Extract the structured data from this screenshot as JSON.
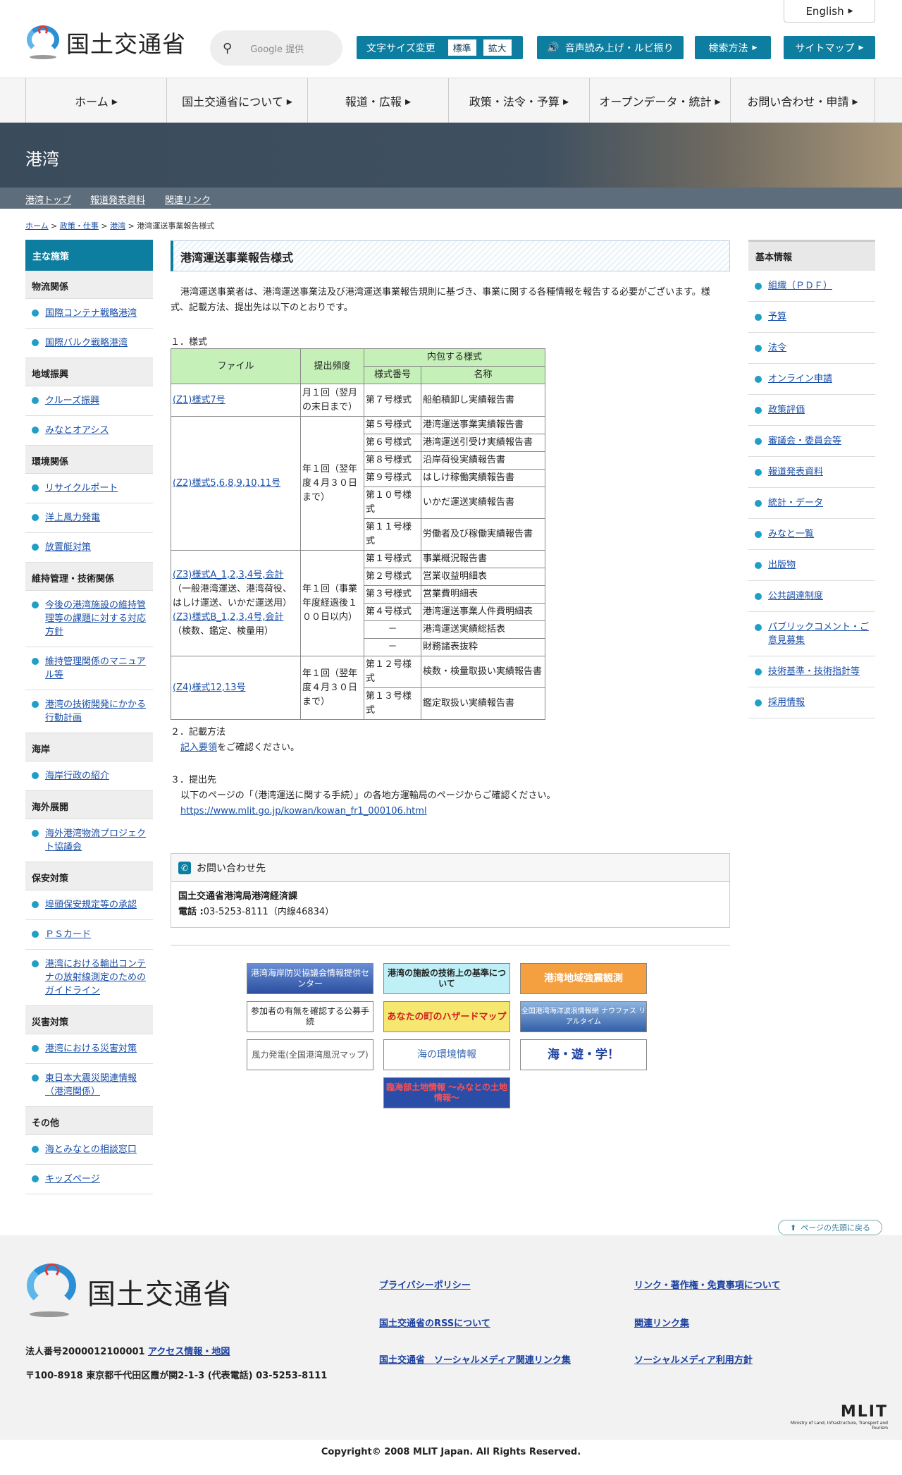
{
  "header": {
    "lang": "English",
    "logo": "国土交通省",
    "search_placeholder": "Google 提供",
    "fontsize": "文字サイズ変更",
    "fs_std": "標準",
    "fs_big": "拡大",
    "voice": "音声読み上げ・ルビ振り",
    "search_method": "検索方法",
    "sitemap": "サイトマップ"
  },
  "gnav": [
    "ホーム",
    "国土交通省について",
    "報道・広報",
    "政策・法令・予算",
    "オープンデータ・統計",
    "お問い合わせ・申請"
  ],
  "banner": {
    "title": "港湾"
  },
  "subnav": [
    "港湾トップ",
    "報道発表資料",
    "関連リンク"
  ],
  "breadcrumb": {
    "home": "ホーム",
    "policy": "政策・仕事",
    "port": "港湾",
    "current": "港湾運送事業報告様式",
    "sep": ">"
  },
  "leftnav": {
    "title": "主な施策",
    "groups": [
      {
        "cat": "物流関係",
        "links": [
          "国際コンテナ戦略港湾",
          "国際バルク戦略港湾"
        ]
      },
      {
        "cat": "地域振興",
        "links": [
          "クルーズ振興",
          "みなとオアシス"
        ]
      },
      {
        "cat": "環境関係",
        "links": [
          "リサイクルポート",
          "洋上風力発電",
          "放置艇対策"
        ]
      },
      {
        "cat": "維持管理・技術関係",
        "links": [
          "今後の港湾施設の維持管理等の課題に対する対応方針",
          "維持管理関係のマニュアル等",
          "港湾の技術開発にかかる行動計画"
        ]
      },
      {
        "cat": "海岸",
        "links": [
          "海岸行政の紹介"
        ]
      },
      {
        "cat": "海外展開",
        "links": [
          "海外港湾物流プロジェクト協議会"
        ]
      },
      {
        "cat": "保安対策",
        "links": [
          "埠頭保安規定等の承認",
          "ＰＳカード",
          "港湾における輸出コンテナの放射線測定のためのガイドライン"
        ]
      },
      {
        "cat": "災害対策",
        "links": [
          "港湾における災害対策",
          "東日本大震災関連情報（港湾関係）"
        ]
      },
      {
        "cat": "その他",
        "links": [
          "海とみなとの相談窓口",
          "キッズページ"
        ]
      }
    ]
  },
  "rightnav": {
    "title": "基本情報",
    "links": [
      "組織（ＰＤＦ）",
      "予算",
      "法令",
      "オンライン申請",
      "政策評価",
      "審議会・委員会等",
      "報道発表資料",
      "統計・データ",
      "みなと一覧",
      "出版物",
      "公共調達制度",
      "パブリックコメント・ご意見募集",
      "技術基準・技術指針等",
      "採用情報"
    ]
  },
  "main": {
    "title": "港湾運送事業報告様式",
    "intro": "港湾運送事業者は、港湾運送事業法及び港湾運送事業報告規則に基づき、事業に関する各種情報を報告する必要がございます。様式、記載方法、提出先は以下のとおりです。",
    "sec1": "１．様式",
    "table": {
      "h_file": "ファイル",
      "h_freq": "提出頻度",
      "h_inc": "内包する様式",
      "h_no": "様式番号",
      "h_name": "名称",
      "z1": "(Z1)様式7号",
      "z1_freq": "月１回（翌月の末日まで）",
      "z1_no": "第７号様式",
      "z1_name": "船舶積卸し実績報告書",
      "z2": "(Z2)様式5,6,8,9,10,11号",
      "z2_freq": "年１回（翌年度４月３０日まで）",
      "z2_rows": [
        [
          "第５号様式",
          "港湾運送事業実績報告書"
        ],
        [
          "第６号様式",
          "港湾運送引受け実績報告書"
        ],
        [
          "第８号様式",
          "沿岸荷役実績報告書"
        ],
        [
          "第９号様式",
          "はしけ稼働実績報告書"
        ],
        [
          "第１０号様式",
          "いかだ運送実績報告書"
        ],
        [
          "第１１号様式",
          "労働者及び稼働実績報告書"
        ]
      ],
      "z3a": "(Z3)様式A_1,2,3,4号,会計",
      "z3a_note": "（一般港湾運送、港湾荷役、はしけ運送、いかだ運送用）",
      "z3b": "(Z3)様式B_1,2,3,4号,会計",
      "z3b_note": "（検数、鑑定、検量用）",
      "z3_freq": "年１回（事業年度経過後１００日以内）",
      "z3_rows": [
        [
          "第１号様式",
          "事業概況報告書"
        ],
        [
          "第２号様式",
          "営業収益明細表"
        ],
        [
          "第３号様式",
          "営業費明細表"
        ],
        [
          "第４号様式",
          "港湾運送事業人件費明細表"
        ],
        [
          "－",
          "港湾運送実績総括表"
        ],
        [
          "－",
          "財務諸表抜粋"
        ]
      ],
      "z4": "(Z4)様式12,13号",
      "z4_freq": "年１回（翌年度４月３０日まで）",
      "z4_rows": [
        [
          "第１２号様式",
          "検数・検量取扱い実績報告書"
        ],
        [
          "第１３号様式",
          "鑑定取扱い実績報告書"
        ]
      ]
    },
    "sec2": "２．記載方法",
    "sec2_link": "記入要領",
    "sec2_text": "をご確認ください。",
    "sec3": "３．提出先",
    "sec3_text": "以下のページの「（港湾運送に関する手続）」の各地方運輸局のページからご確認ください。",
    "sec3_url": "https://www.mlit.go.jp/kowan/kowan_fr1_000106.html",
    "contact": {
      "title": "お問い合わせ先",
      "org": "国土交通省港湾局港湾経済課",
      "tel_label": "電話 :",
      "tel": "03-5253-8111（内線46834）"
    }
  },
  "banners": [
    "港湾海岸防災協議会情報提供センター",
    "港湾の施設の技術上の基準について",
    "港湾地域強震観測",
    "参加者の有無を確認する公募手続",
    "あなたの町のハザードマップ",
    "全国港湾海洋波浪情報網 ナウファス リアルタイム",
    "風力発電(全国港湾風況マップ)",
    "海の環境情報",
    "海・遊・学！",
    "臨海部土地情報 ～みなとの土地情報～"
  ],
  "colors": {
    "accent": "#0d7da0",
    "table_header": "#c5f0b8"
  },
  "footer": {
    "totop": "ページの先頭に戻る",
    "logo": "国土交通省",
    "corp_no": "法人番号2000012100001",
    "access": "アクセス情報・地図",
    "address": "〒100-8918 東京都千代田区霞が関2-1-3 (代表電話) 03-5253-8111",
    "links": [
      "プライバシーポリシー",
      "リンク・著作権・免責事項について",
      "国土交通省のRSSについて",
      "関連リンク集",
      "国土交通省　ソーシャルメディア関連リンク集",
      "ソーシャルメディア利用方針"
    ],
    "mlit": "MLIT",
    "mlit_sub": "Ministry of Land, Infrastructure, Transport and Tourism",
    "copyright": "Copyright© 2008 MLIT Japan. All Rights Reserved."
  }
}
